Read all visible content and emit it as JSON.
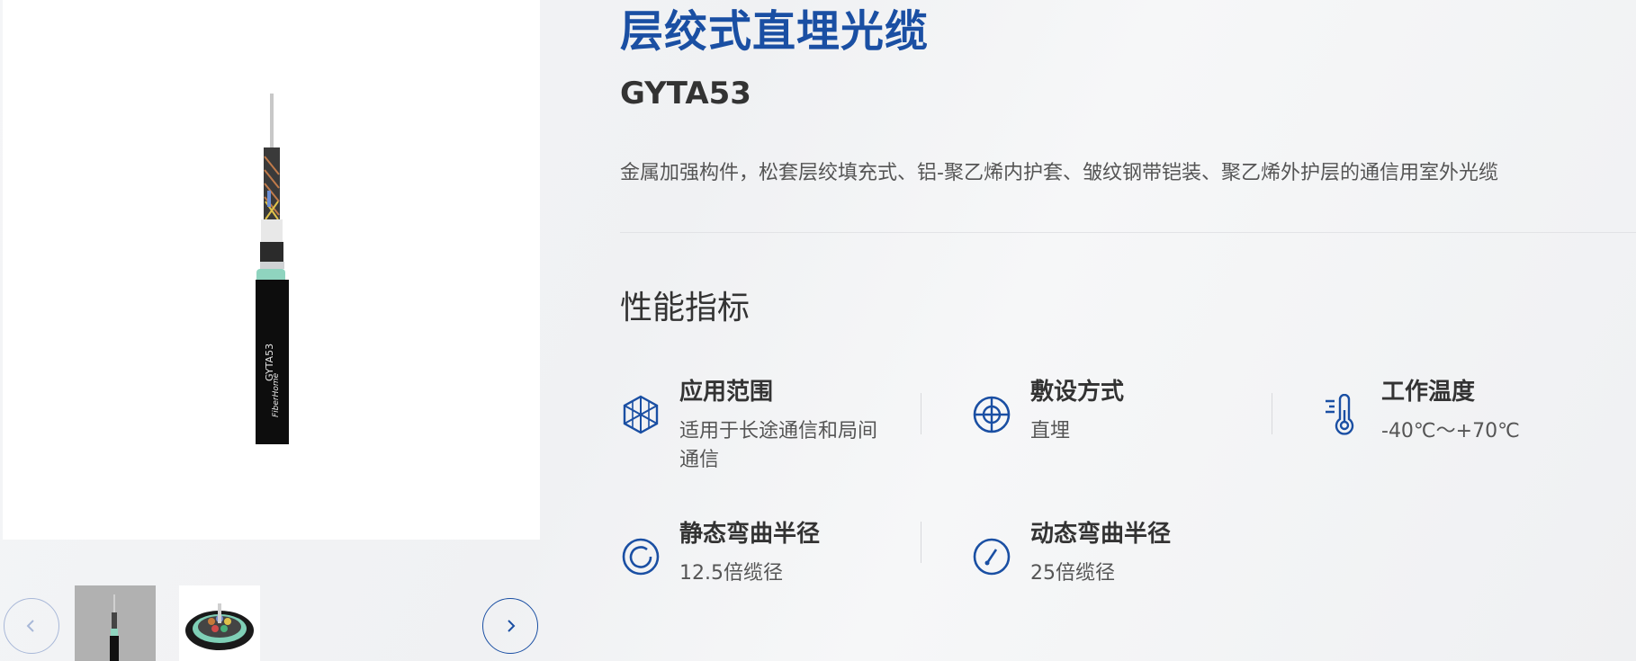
{
  "product": {
    "title": "层绞式直埋光缆",
    "model": "GYTA53",
    "description": "金属加强构件，松套层绞填充式、铝-聚乙烯内护套、皱纹钢带铠装、聚乙烯外护层的通信用室外光缆"
  },
  "gallery": {
    "cable_print_brand": "FiberHome",
    "cable_print_model": "GYTA53",
    "prev_icon": "chevron-left-icon",
    "next_icon": "chevron-right-icon"
  },
  "performance": {
    "section_title": "性能指标",
    "specs": [
      {
        "label": "应用范围",
        "value": "适用于长途通信和局间通信",
        "icon": "network-icon"
      },
      {
        "label": "敷设方式",
        "value": "直埋",
        "icon": "crosshair-icon"
      },
      {
        "label": "工作温度",
        "value": "-40℃～+70℃",
        "icon": "thermometer-icon"
      },
      {
        "label": "静态弯曲半径",
        "value": "12.5倍缆径",
        "icon": "static-bend-icon"
      },
      {
        "label": "动态弯曲半径",
        "value": "25倍缆径",
        "icon": "dynamic-bend-icon"
      }
    ]
  },
  "colors": {
    "brand_blue": "#1a4fa3",
    "text_dark": "#333333",
    "text_muted": "#555555"
  }
}
